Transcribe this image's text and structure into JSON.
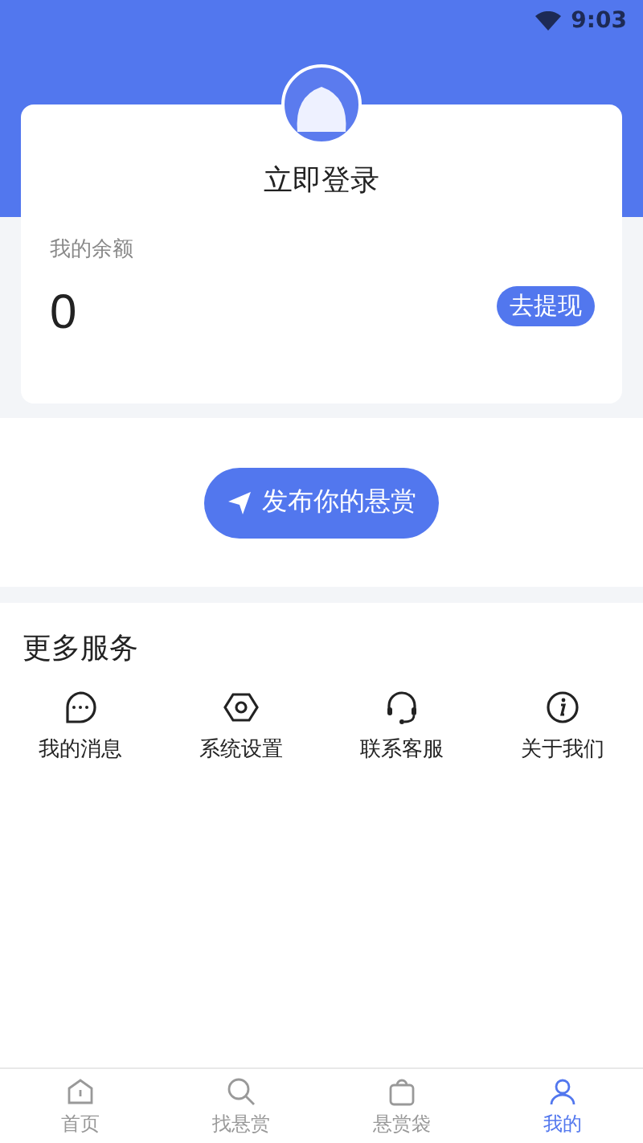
{
  "status_bar": {
    "time": "9:03"
  },
  "profile": {
    "login_label": "立即登录",
    "balance_label": "我的余额",
    "balance": "0",
    "withdraw_button": "去提现"
  },
  "publish_button": "发布你的悬赏",
  "services": {
    "title": "更多服务",
    "items": [
      {
        "kind": "message",
        "label": "我的消息"
      },
      {
        "kind": "settings",
        "label": "系统设置"
      },
      {
        "kind": "support",
        "label": "联系客服"
      },
      {
        "kind": "about",
        "label": "关于我们"
      }
    ]
  },
  "tab_bar": [
    {
      "kind": "home",
      "label": "首页",
      "selected": false
    },
    {
      "kind": "search",
      "label": "找悬赏",
      "selected": false
    },
    {
      "kind": "bag",
      "label": "悬赏袋",
      "selected": false
    },
    {
      "kind": "me",
      "label": "我的",
      "selected": true
    }
  ]
}
